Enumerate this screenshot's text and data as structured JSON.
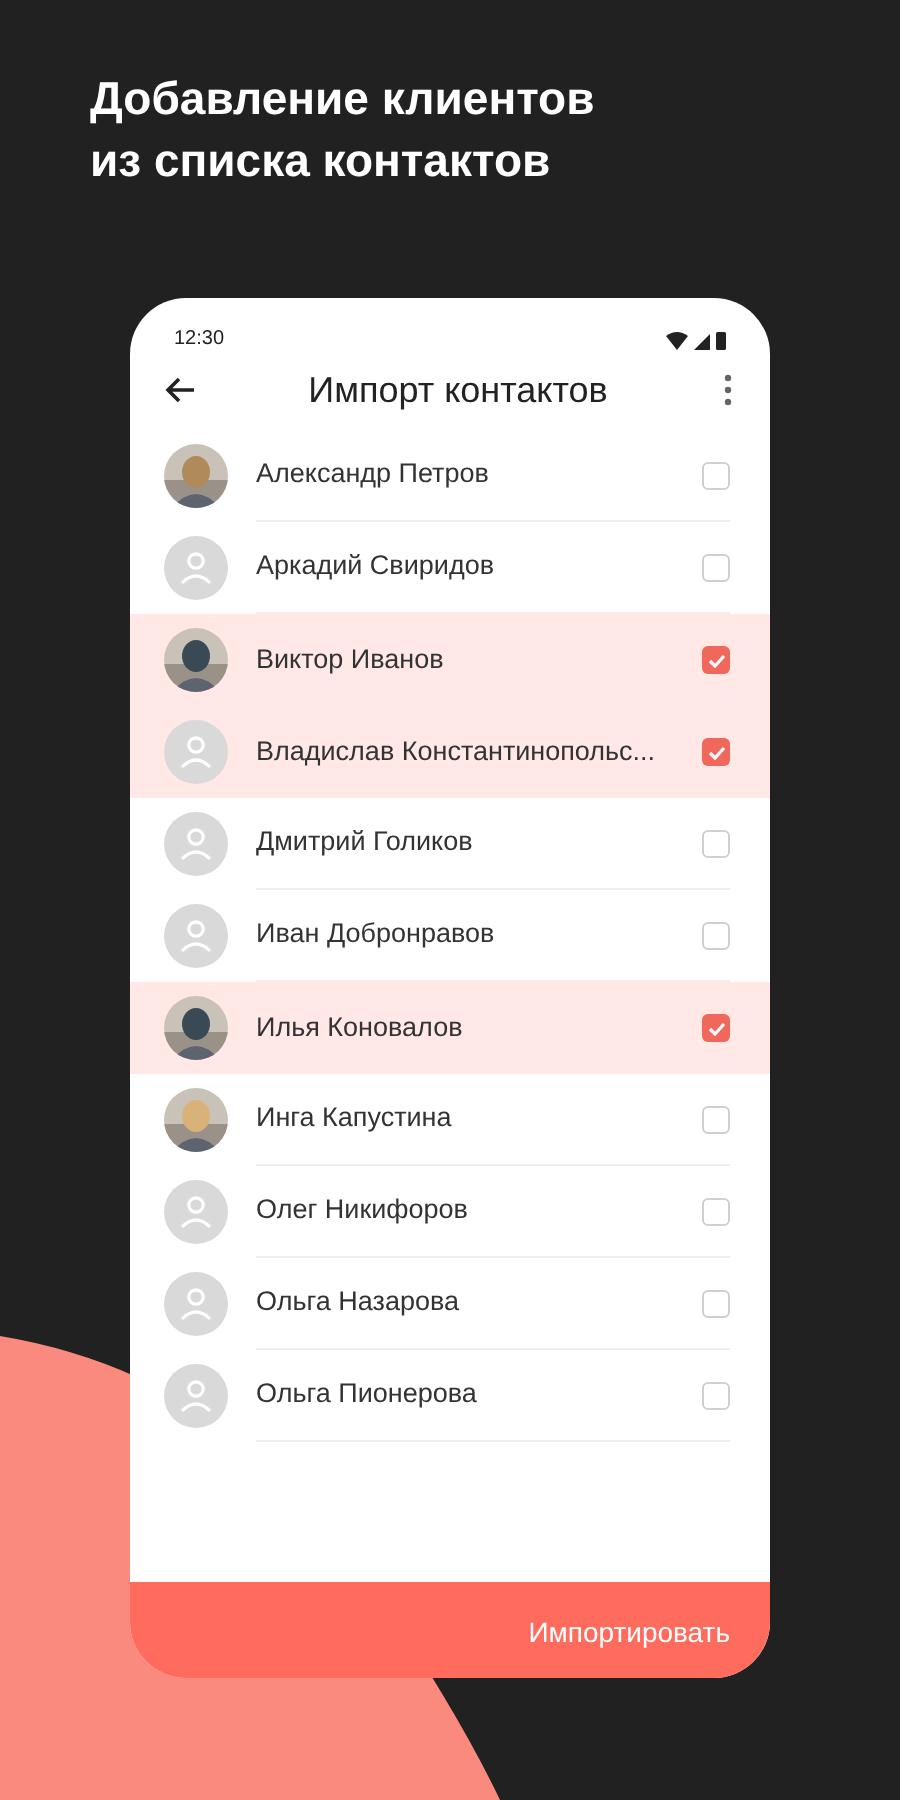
{
  "headline": [
    "Добавление клиентов",
    "из списка контактов"
  ],
  "status_bar": {
    "time": "12:30"
  },
  "toolbar": {
    "title": "Импорт контактов"
  },
  "contacts": [
    {
      "name": "Александр Петров",
      "kind": "picture",
      "checked": false
    },
    {
      "name": "Аркадий Свиридов",
      "kind": "placeholder",
      "checked": false
    },
    {
      "name": "Виктор Иванов",
      "kind": "picture",
      "checked": true
    },
    {
      "name": "Владислав Константинопольс...",
      "kind": "placeholder",
      "checked": true
    },
    {
      "name": "Дмитрий Голиков",
      "kind": "placeholder",
      "checked": false
    },
    {
      "name": "Иван Добронравов",
      "kind": "placeholder",
      "checked": false
    },
    {
      "name": "Илья Коновалов",
      "kind": "picture",
      "checked": true
    },
    {
      "name": "Инга Капустина",
      "kind": "picture",
      "checked": false
    },
    {
      "name": "Олег Никифоров",
      "kind": "placeholder",
      "checked": false
    },
    {
      "name": "Ольга Назарова",
      "kind": "placeholder",
      "checked": false
    },
    {
      "name": "Ольга Пионерова",
      "kind": "placeholder",
      "checked": false
    }
  ],
  "import_button": "Импортировать"
}
